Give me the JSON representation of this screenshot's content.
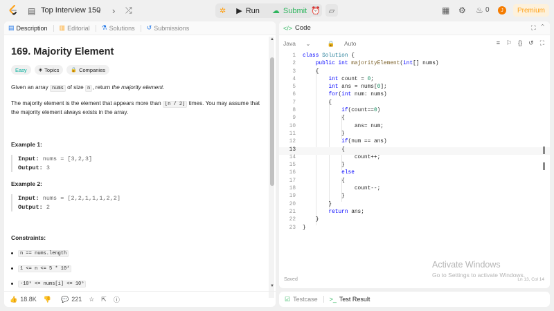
{
  "topbar": {
    "title": "Top Interview 150",
    "prev_glyph": "‹",
    "next_glyph": "›",
    "shuffle_glyph": "⤮",
    "run_label": "Run",
    "submit_label": "Submit",
    "fire_count": "0",
    "avatar_initial": "J",
    "premium_label": "Premium"
  },
  "left_tabs": [
    "Description",
    "Editorial",
    "Solutions",
    "Submissions"
  ],
  "problem": {
    "title": "169. Majority Element",
    "difficulty": "Easy",
    "topics_label": "Topics",
    "companies_label": "Companies",
    "p1_pre": "Given an array ",
    "p1_code": "nums",
    "p1_mid": " of size ",
    "p1_code2": "n",
    "p1_post": ", return ",
    "p1_em": "the majority element",
    "p1_end": ".",
    "p2_pre": "The majority element is the element that appears more than ",
    "p2_code": "⌊n / 2⌋",
    "p2_post": " times. You may assume that the majority element always exists in the array.",
    "example1_title": "Example 1:",
    "example1_input": "nums = [3,2,3]",
    "example1_output": "3",
    "example2_title": "Example 2:",
    "example2_input": "nums = [2,2,1,1,1,2,2]",
    "example2_output": "2",
    "input_label": "Input:",
    "output_label": "Output:",
    "constraints_title": "Constraints:",
    "constraints": [
      "n == nums.length",
      "1 <= n <= 5 * 10⁴",
      "-10⁹ <= nums[i] <= 10⁹"
    ]
  },
  "left_bottom": {
    "likes": "18.8K",
    "comments": "221"
  },
  "code_panel": {
    "title": "Code",
    "language": "Java",
    "mode": "Auto",
    "saved": "Saved",
    "cursor": "Ln 13, Col 14",
    "lines": [
      "class Solution {",
      "    public int majorityElement(int[] nums)",
      "    {",
      "        int count = 0;",
      "        int ans = nums[0];",
      "        for(int num: nums)",
      "        {",
      "            if(count==0)",
      "            {",
      "                ans= num;",
      "            }",
      "            if(num == ans)",
      "            {",
      "                count++;",
      "            }",
      "            else",
      "            {",
      "                count--;",
      "            }",
      "        }",
      "        return ans;",
      "    }",
      "}"
    ],
    "current_line": 13
  },
  "watermark": {
    "line1": "Activate Windows",
    "line2": "Go to Settings to activate Windows."
  },
  "bottom_tabs": {
    "testcase": "Testcase",
    "result": "Test Result"
  },
  "colors": {
    "accent_green": "#2db55d",
    "premium": "#ffa116",
    "easy": "#00af9b"
  }
}
